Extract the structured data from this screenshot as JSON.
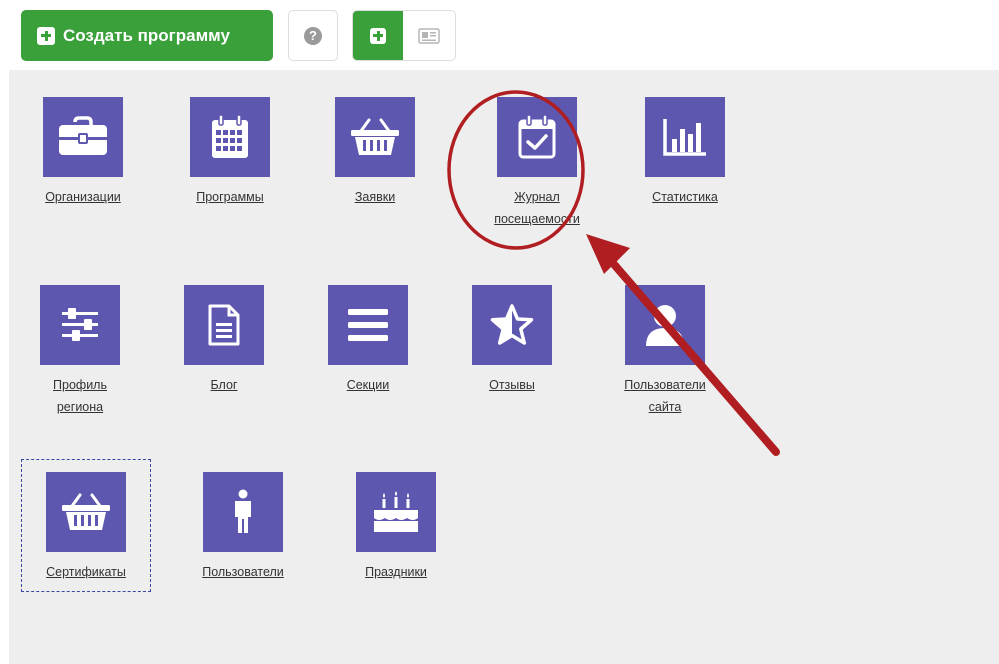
{
  "toolbar": {
    "create_label": "Создать программу",
    "help_glyph": "?"
  },
  "tiles": [
    {
      "key": "organizations",
      "label": "Организации",
      "icon": "briefcase-icon"
    },
    {
      "key": "programs",
      "label": "Программы",
      "icon": "calendar-grid-icon"
    },
    {
      "key": "requests",
      "label": "Заявки",
      "icon": "basket-icon"
    },
    {
      "key": "attendance",
      "label1": "Журнал",
      "label2": "посещаемости",
      "icon": "calendar-check-icon"
    },
    {
      "key": "statistics",
      "label": "Статистика",
      "icon": "bar-chart-icon"
    },
    {
      "key": "region-profile",
      "label1": "Профиль",
      "label2": "региона",
      "icon": "sliders-icon"
    },
    {
      "key": "blog",
      "label": "Блог",
      "icon": "document-icon"
    },
    {
      "key": "sections",
      "label": "Секции",
      "icon": "list-icon"
    },
    {
      "key": "reviews",
      "label": "Отзывы",
      "icon": "star-half-icon"
    },
    {
      "key": "site-users",
      "label1": "Пользователи",
      "label2": "сайта",
      "icon": "user-icon"
    },
    {
      "key": "certificates",
      "label": "Сертификаты",
      "icon": "basket-icon"
    },
    {
      "key": "users",
      "label": "Пользователи",
      "icon": "person-icon"
    },
    {
      "key": "holidays",
      "label": "Праздники",
      "icon": "cake-icon"
    }
  ],
  "colors": {
    "tile_bg": "#5d57b0",
    "green": "#3aa03a",
    "annotation": "#b01e22",
    "panel_bg": "#eeeeee"
  }
}
